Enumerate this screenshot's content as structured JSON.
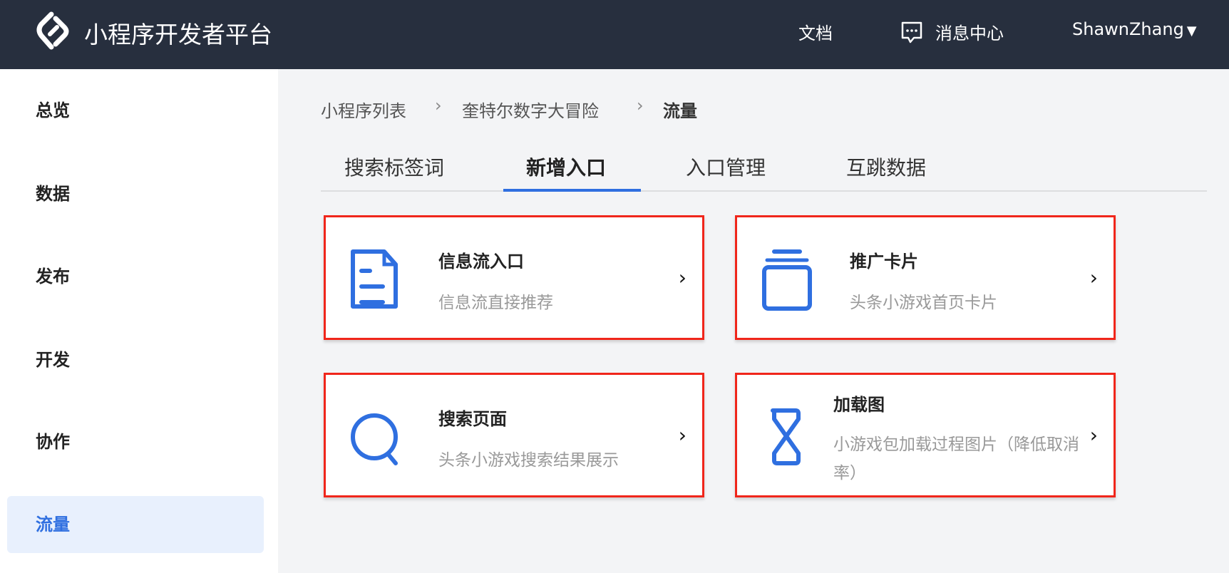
{
  "header": {
    "brand": "小程序开发者平台",
    "docs": "文档",
    "messages": "消息中心",
    "user": "ShawnZhang"
  },
  "sidebar": {
    "items": [
      {
        "label": "总览"
      },
      {
        "label": "数据"
      },
      {
        "label": "发布"
      },
      {
        "label": "开发"
      },
      {
        "label": "协作"
      },
      {
        "label": "流量",
        "active": true
      }
    ]
  },
  "breadcrumb": [
    "小程序列表",
    "奎特尔数字大冒险",
    "流量"
  ],
  "tabs": [
    {
      "label": "搜索标签词"
    },
    {
      "label": "新增入口",
      "active": true
    },
    {
      "label": "入口管理"
    },
    {
      "label": "互跳数据"
    }
  ],
  "cards": [
    {
      "title": "信息流入口",
      "desc": "信息流直接推荐",
      "icon": "document-icon"
    },
    {
      "title": "推广卡片",
      "desc": "头条小游戏首页卡片",
      "icon": "card-stack-icon"
    },
    {
      "title": "搜索页面",
      "desc": "头条小游戏搜索结果展示",
      "icon": "search-icon"
    },
    {
      "title": "加载图",
      "desc": "小游戏包加载过程图片（降低取消率）",
      "icon": "hourglass-icon"
    }
  ],
  "colors": {
    "accent": "#2f6fe0",
    "header_bg": "#272f3e",
    "highlight_border": "#f0261b"
  }
}
